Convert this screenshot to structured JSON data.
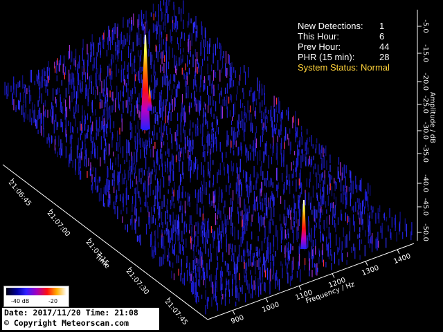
{
  "stats": {
    "rows": [
      {
        "label": "New Detections:",
        "value": "1"
      },
      {
        "label": "This Hour:",
        "value": "6"
      },
      {
        "label": "Prev Hour:",
        "value": "44"
      },
      {
        "label": "PHR (15 min):",
        "value": "28"
      }
    ],
    "status": "System Status: Normal"
  },
  "amplitude_axis": {
    "title": "Amplitude / dB",
    "ticks": [
      "-5.0",
      "-15.0",
      "-20.0",
      "-25.0",
      "-30.0",
      "-35.0",
      "-40.0",
      "-45.0",
      "-50.0"
    ]
  },
  "frequency_axis": {
    "title": "Frequency / Hz",
    "ticks": [
      "900",
      "1000",
      "1100",
      "1200",
      "1300",
      "1400"
    ]
  },
  "time_axis": {
    "title": "Time",
    "ticks": [
      "21:06:45",
      "21:07:00",
      "21:07:15",
      "21:07:30",
      "21:07:45"
    ]
  },
  "legend": {
    "low_label": "-40 dB",
    "high_label": "-20"
  },
  "footer": {
    "date_line": "Date: 2017/11/20 Time: 21:08",
    "copyright": "© Copyright Meteorscan.com"
  },
  "colors": {
    "status": "#ffd23a",
    "noise_base": "#1a1acc",
    "peak_hot": "#ffffff"
  }
}
